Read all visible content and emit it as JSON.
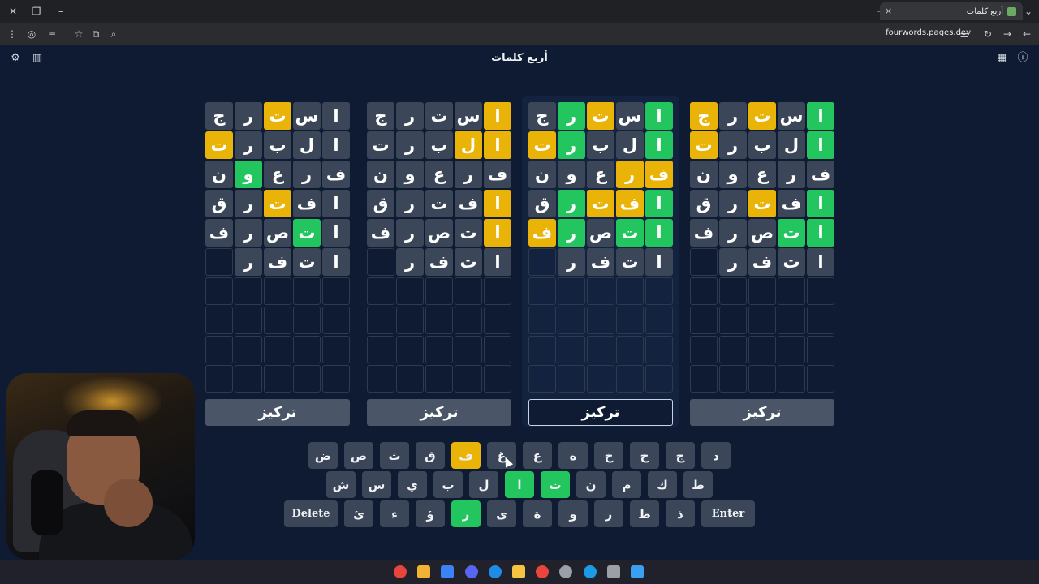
{
  "browser": {
    "tab_title": "أربع كلمات",
    "url": "fourwords.pages.dev",
    "tab_close": "×",
    "new_tab": "+",
    "window_close": "✕",
    "window_restore": "❐",
    "window_min": "–",
    "menu": "⋮",
    "star": "☆",
    "back": "←",
    "forward": "→",
    "reload": "↻",
    "dropdown": "⌄"
  },
  "app": {
    "title": "أربع كلمات",
    "icons": [
      "gear-icon",
      "bar-chart-icon",
      "calendar-icon",
      "info-icon"
    ],
    "gear": "⚙",
    "chart": "▥",
    "calendar": "▦",
    "info": "ⓘ"
  },
  "boards": [
    {
      "focus_label": "تركيز",
      "focused": false,
      "rows": [
        {
          "letters": [
            "ا",
            "س",
            "ت",
            "ر",
            "ج"
          ],
          "states": [
            "green",
            "gray",
            "yellow",
            "gray",
            "yellow"
          ]
        },
        {
          "letters": [
            "ا",
            "ل",
            "ب",
            "ر",
            "ت"
          ],
          "states": [
            "green",
            "gray",
            "gray",
            "gray",
            "yellow"
          ]
        },
        {
          "letters": [
            "ف",
            "ر",
            "ع",
            "و",
            "ن"
          ],
          "states": [
            "gray",
            "gray",
            "gray",
            "gray",
            "gray"
          ]
        },
        {
          "letters": [
            "ا",
            "ف",
            "ت",
            "ر",
            "ق"
          ],
          "states": [
            "green",
            "gray",
            "yellow",
            "gray",
            "gray"
          ]
        },
        {
          "letters": [
            "ا",
            "ت",
            "ص",
            "ر",
            "ف"
          ],
          "states": [
            "green",
            "green",
            "gray",
            "gray",
            "gray"
          ]
        },
        {
          "letters": [
            "ا",
            "ت",
            "ف",
            "ر",
            ""
          ],
          "states": [
            "gray",
            "gray",
            "gray",
            "gray",
            "empty"
          ]
        }
      ]
    },
    {
      "focus_label": "تركيز",
      "focused": true,
      "rows": [
        {
          "letters": [
            "ا",
            "س",
            "ت",
            "ر",
            "ج"
          ],
          "states": [
            "green",
            "gray",
            "yellow",
            "green",
            "gray"
          ]
        },
        {
          "letters": [
            "ا",
            "ل",
            "ب",
            "ر",
            "ت"
          ],
          "states": [
            "green",
            "gray",
            "gray",
            "green",
            "yellow"
          ]
        },
        {
          "letters": [
            "ف",
            "ر",
            "ع",
            "و",
            "ن"
          ],
          "states": [
            "yellow",
            "yellow",
            "gray",
            "gray",
            "gray"
          ]
        },
        {
          "letters": [
            "ا",
            "ف",
            "ت",
            "ر",
            "ق"
          ],
          "states": [
            "green",
            "yellow",
            "yellow",
            "green",
            "gray"
          ]
        },
        {
          "letters": [
            "ا",
            "ت",
            "ص",
            "ر",
            "ف"
          ],
          "states": [
            "green",
            "green",
            "gray",
            "green",
            "yellow"
          ]
        },
        {
          "letters": [
            "ا",
            "ت",
            "ف",
            "ر",
            ""
          ],
          "states": [
            "gray",
            "gray",
            "gray",
            "gray",
            "empty"
          ]
        }
      ]
    },
    {
      "focus_label": "تركيز",
      "focused": false,
      "rows": [
        {
          "letters": [
            "ا",
            "س",
            "ت",
            "ر",
            "ج"
          ],
          "states": [
            "yellow",
            "gray",
            "gray",
            "gray",
            "gray"
          ]
        },
        {
          "letters": [
            "ا",
            "ل",
            "ب",
            "ر",
            "ت"
          ],
          "states": [
            "yellow",
            "yellow",
            "gray",
            "gray",
            "gray"
          ]
        },
        {
          "letters": [
            "ف",
            "ر",
            "ع",
            "و",
            "ن"
          ],
          "states": [
            "gray",
            "gray",
            "gray",
            "gray",
            "gray"
          ]
        },
        {
          "letters": [
            "ا",
            "ف",
            "ت",
            "ر",
            "ق"
          ],
          "states": [
            "yellow",
            "gray",
            "gray",
            "gray",
            "gray"
          ]
        },
        {
          "letters": [
            "ا",
            "ت",
            "ص",
            "ر",
            "ف"
          ],
          "states": [
            "yellow",
            "gray",
            "gray",
            "gray",
            "gray"
          ]
        },
        {
          "letters": [
            "ا",
            "ت",
            "ف",
            "ر",
            ""
          ],
          "states": [
            "gray",
            "gray",
            "gray",
            "gray",
            "empty"
          ]
        }
      ]
    },
    {
      "focus_label": "تركيز",
      "focused": false,
      "rows": [
        {
          "letters": [
            "ا",
            "س",
            "ت",
            "ر",
            "ج"
          ],
          "states": [
            "gray",
            "gray",
            "yellow",
            "gray",
            "gray"
          ]
        },
        {
          "letters": [
            "ا",
            "ل",
            "ب",
            "ر",
            "ت"
          ],
          "states": [
            "gray",
            "gray",
            "gray",
            "gray",
            "yellow"
          ]
        },
        {
          "letters": [
            "ف",
            "ر",
            "ع",
            "و",
            "ن"
          ],
          "states": [
            "gray",
            "gray",
            "gray",
            "green",
            "gray"
          ]
        },
        {
          "letters": [
            "ا",
            "ف",
            "ت",
            "ر",
            "ق"
          ],
          "states": [
            "gray",
            "gray",
            "yellow",
            "gray",
            "gray"
          ]
        },
        {
          "letters": [
            "ا",
            "ت",
            "ص",
            "ر",
            "ف"
          ],
          "states": [
            "gray",
            "green",
            "gray",
            "gray",
            "gray"
          ]
        },
        {
          "letters": [
            "ا",
            "ت",
            "ف",
            "ر",
            ""
          ],
          "states": [
            "gray",
            "gray",
            "gray",
            "gray",
            "empty"
          ]
        }
      ]
    }
  ],
  "keyboard": {
    "rows": [
      [
        {
          "label": "د",
          "state": "gray"
        },
        {
          "label": "ج",
          "state": "gray"
        },
        {
          "label": "ح",
          "state": "gray"
        },
        {
          "label": "خ",
          "state": "gray"
        },
        {
          "label": "ه",
          "state": "gray"
        },
        {
          "label": "ع",
          "state": "gray"
        },
        {
          "label": "غ",
          "state": "gray"
        },
        {
          "label": "ف",
          "state": "yellow"
        },
        {
          "label": "ق",
          "state": "gray"
        },
        {
          "label": "ث",
          "state": "gray"
        },
        {
          "label": "ص",
          "state": "gray"
        },
        {
          "label": "ض",
          "state": "gray"
        }
      ],
      [
        {
          "label": "ط",
          "state": "gray"
        },
        {
          "label": "ك",
          "state": "gray"
        },
        {
          "label": "م",
          "state": "gray"
        },
        {
          "label": "ن",
          "state": "gray"
        },
        {
          "label": "ت",
          "state": "green"
        },
        {
          "label": "ا",
          "state": "green"
        },
        {
          "label": "ل",
          "state": "gray"
        },
        {
          "label": "ب",
          "state": "gray"
        },
        {
          "label": "ي",
          "state": "gray"
        },
        {
          "label": "س",
          "state": "gray"
        },
        {
          "label": "ش",
          "state": "gray"
        }
      ],
      [
        {
          "label": "Enter",
          "state": "gray",
          "wide": true
        },
        {
          "label": "ذ",
          "state": "gray"
        },
        {
          "label": "ظ",
          "state": "gray"
        },
        {
          "label": "ز",
          "state": "gray"
        },
        {
          "label": "و",
          "state": "gray"
        },
        {
          "label": "ة",
          "state": "gray"
        },
        {
          "label": "ى",
          "state": "gray"
        },
        {
          "label": "ر",
          "state": "green"
        },
        {
          "label": "ؤ",
          "state": "gray"
        },
        {
          "label": "ء",
          "state": "gray"
        },
        {
          "label": "ئ",
          "state": "gray"
        },
        {
          "label": "Delete",
          "state": "gray",
          "wide": true
        }
      ]
    ]
  },
  "colors": {
    "green": "#22c55e",
    "yellow": "#eab308",
    "gray": "#3b4658",
    "background": "#0f1a33"
  },
  "taskbar": {
    "icons": [
      "chrome-icon",
      "app-r-icon",
      "app-blue-icon",
      "discord-icon",
      "edge-icon",
      "folder-icon",
      "chrome-icon",
      "obs-icon",
      "steam-icon",
      "settings-icon",
      "windows-icon"
    ]
  }
}
